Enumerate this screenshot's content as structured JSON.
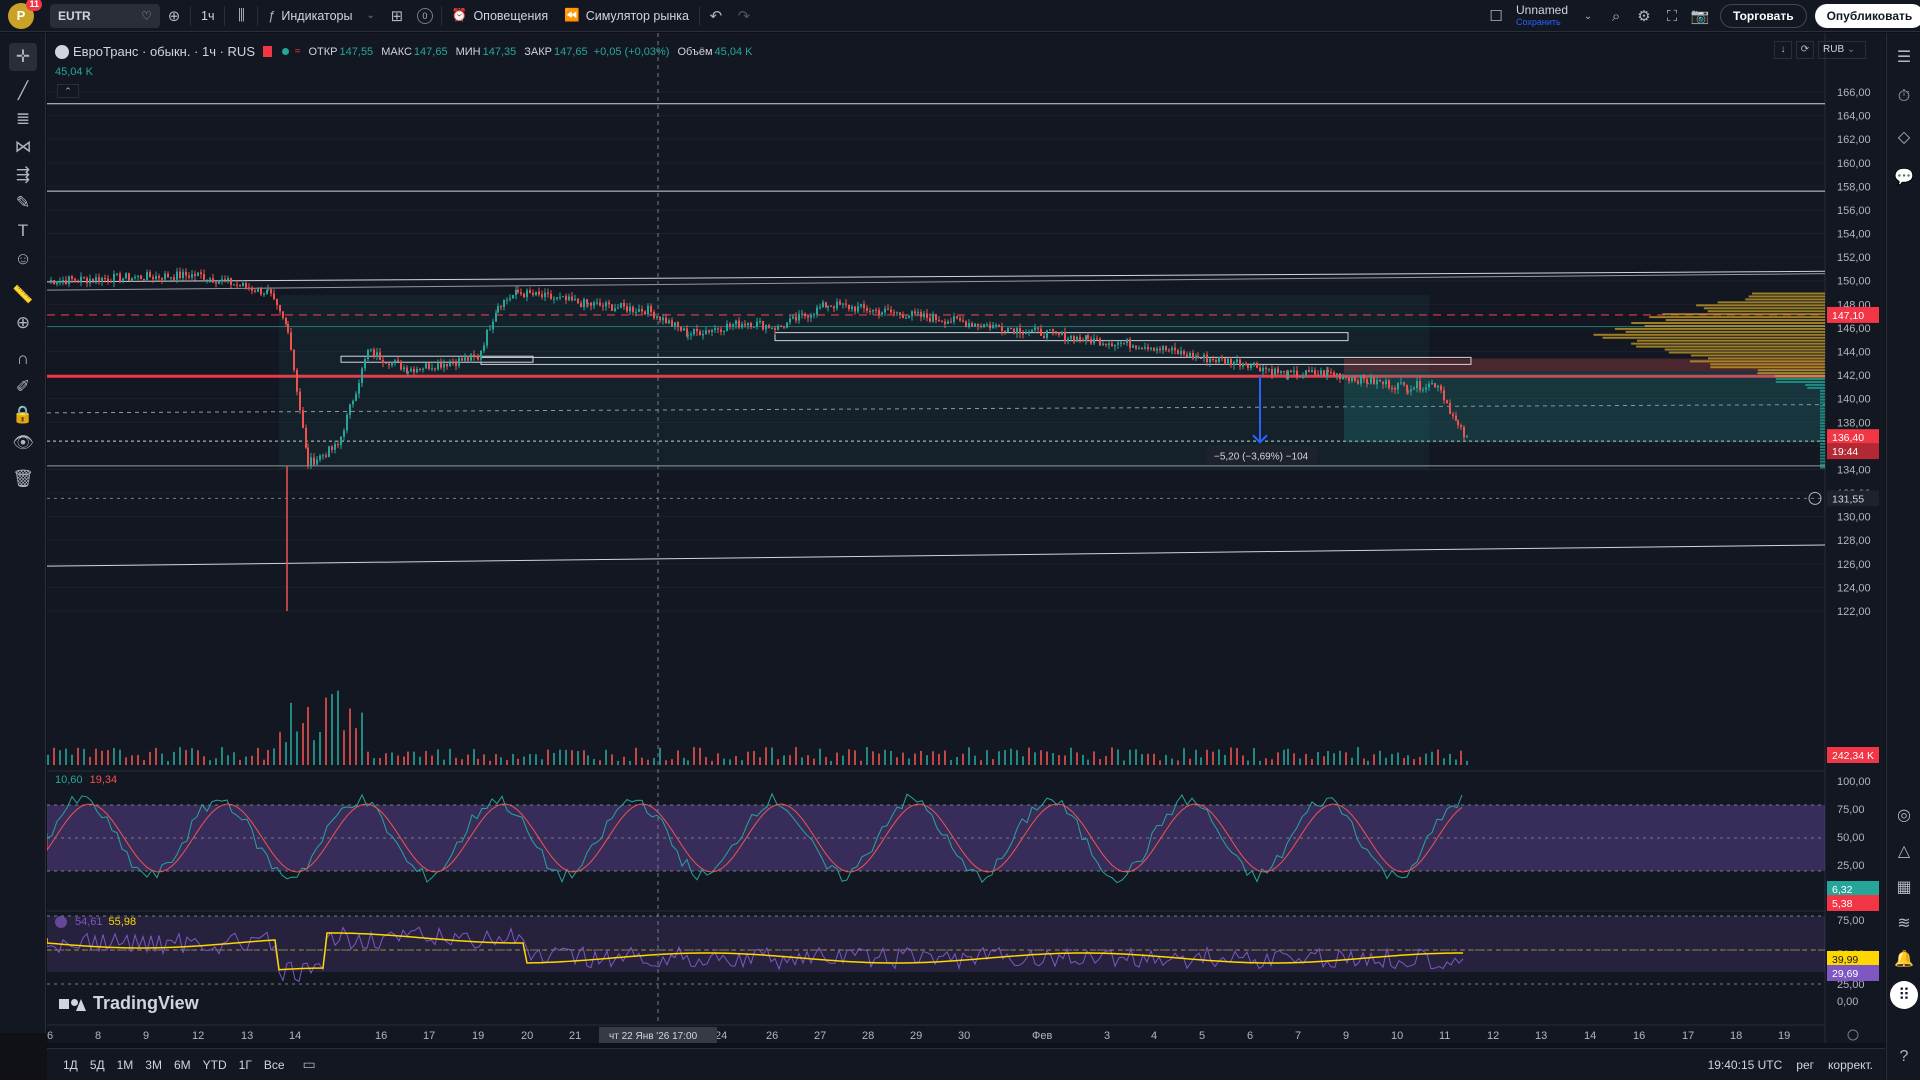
{
  "topbar": {
    "avatar_letter": "P",
    "notification_count": "11",
    "symbol": "EUTR",
    "interval": "1ч",
    "indicators_label": "Индикаторы",
    "templates_count": "0",
    "alerts_label": "Оповещения",
    "simulator_label": "Симулятор рынка",
    "layout_name": "Unnamed",
    "layout_status": "Сохранить",
    "trade_label": "Торговать",
    "publish_label": "Опубликовать"
  },
  "legend": {
    "title": "ЕвроТранс · обыкн. · 1ч · RUS",
    "open_label": "ОТКР",
    "open_value": "147,55",
    "high_label": "МАКС",
    "high_value": "147,65",
    "low_label": "МИН",
    "low_value": "147,35",
    "close_label": "ЗАКР",
    "close_value": "147,65",
    "change_value": "+0,05 (+0,03%)",
    "volume_label": "Объём",
    "volume_value": "45,04 K",
    "volume_sub": "45,04 K"
  },
  "price_axis": {
    "currency": "RUB",
    "ticks": [
      "166,00",
      "164,00",
      "162,00",
      "160,00",
      "158,00",
      "156,00",
      "154,00",
      "152,00",
      "150,00",
      "148,00",
      "146,00",
      "144,00",
      "142,00",
      "140,00",
      "138,00",
      "136,00",
      "134,00",
      "132,00",
      "130,00",
      "128,00",
      "126,00",
      "124,00",
      "122,00"
    ],
    "badge_147": "147,10",
    "badge_current": "136,40",
    "badge_countdown": "19:44",
    "badge_alert": "131,55",
    "badge_volume": "242,34 K"
  },
  "measure_label": "−5,20 (−3,69%) −104",
  "stoch": {
    "values": [
      "10,60",
      "19,34"
    ],
    "ticks": [
      "100,00",
      "75,00",
      "50,00",
      "25,00"
    ],
    "badge_a": "6,32",
    "badge_b": "5,38"
  },
  "rsi": {
    "values": [
      "54,61",
      "55,98"
    ],
    "ticks": [
      "75,00",
      "50,00",
      "25,00",
      "0,00"
    ],
    "badge_a": "39,99",
    "badge_b": "29,69"
  },
  "time_axis": {
    "labels": [
      "6",
      "8",
      "9",
      "12",
      "13",
      "14",
      "16",
      "17",
      "19",
      "20",
      "21",
      "22",
      "24",
      "26",
      "27",
      "28",
      "29",
      "30",
      "Фев",
      "3",
      "4",
      "5",
      "6",
      "7",
      "9",
      "10",
      "11",
      "12",
      "13",
      "14",
      "16",
      "17",
      "18",
      "19"
    ],
    "crosshair_label": "чт 22 Янв '26   17:00"
  },
  "bottombar": {
    "ranges": [
      "1Д",
      "5Д",
      "1М",
      "3М",
      "6М",
      "YTD",
      "1Г",
      "Все"
    ],
    "clock": "19:40:15 UTC",
    "session": "рег",
    "adjust": "коррект."
  },
  "watermark": "TradingView",
  "colors": {
    "up": "#26a69a",
    "down": "#ef5350",
    "accent": "#2962ff",
    "red_line": "#f23645",
    "rsi_line": "#7e57c2",
    "rsi_ma": "#ffd600"
  }
}
